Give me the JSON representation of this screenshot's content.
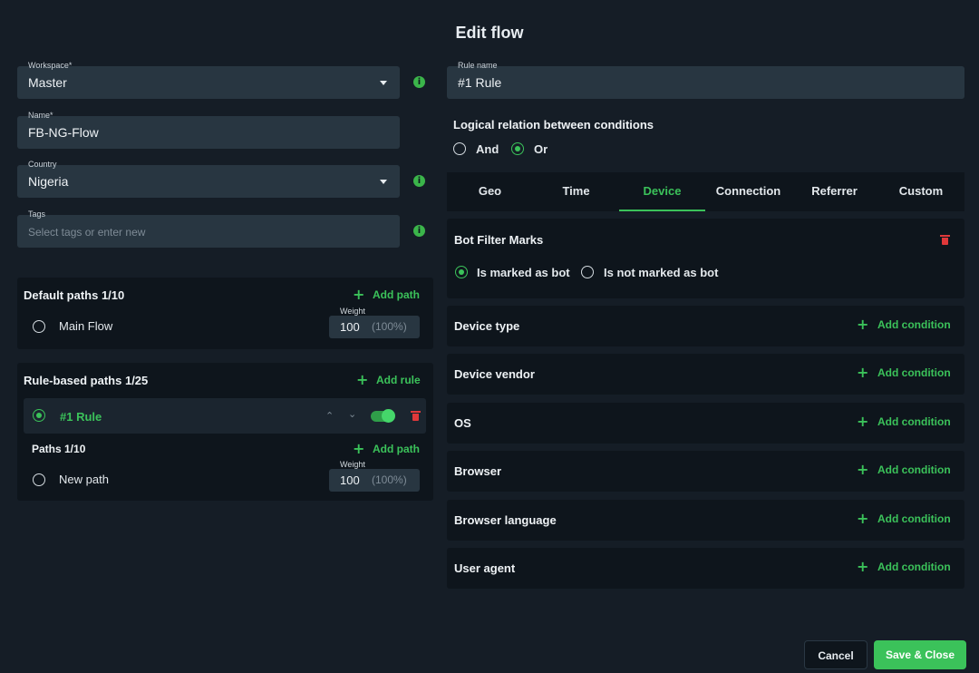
{
  "dialog": {
    "title": "Edit flow"
  },
  "form": {
    "workspace": {
      "label": "Workspace*",
      "value": "Master"
    },
    "name": {
      "label": "Name*",
      "value": "FB-NG-Flow"
    },
    "country": {
      "label": "Country",
      "value": "Nigeria"
    },
    "tags": {
      "label": "Tags",
      "placeholder": "Select tags or enter new"
    }
  },
  "default_paths": {
    "title": "Default paths 1/10",
    "add_label": "Add path",
    "items": [
      {
        "name": "Main Flow",
        "weight_label": "Weight",
        "weight": "100",
        "percent": "(100%)"
      }
    ]
  },
  "rule_paths": {
    "title": "Rule-based paths 1/25",
    "add_label": "Add rule",
    "rule": {
      "name": "#1 Rule",
      "enabled": true
    },
    "paths_title": "Paths 1/10",
    "add_path_label": "Add path",
    "items": [
      {
        "name": "New path",
        "weight_label": "Weight",
        "weight": "100",
        "percent": "(100%)"
      }
    ]
  },
  "rule": {
    "name_label": "Rule name",
    "name_value": "#1 Rule",
    "logic_title": "Logical relation between conditions",
    "logic_options": [
      "And",
      "Or"
    ],
    "logic_selected": "Or"
  },
  "tabs": [
    "Geo",
    "Time",
    "Device",
    "Connection",
    "Referrer",
    "Custom"
  ],
  "active_tab": "Device",
  "bot_filter": {
    "title": "Bot Filter Marks",
    "options": [
      "Is marked as bot",
      "Is not marked as bot"
    ],
    "selected": "Is marked as bot"
  },
  "conditions": {
    "add_label": "Add condition",
    "rows": [
      "Device type",
      "Device vendor",
      "OS",
      "Browser",
      "Browser language",
      "User agent"
    ]
  },
  "buttons": {
    "cancel": "Cancel",
    "save": "Save & Close"
  },
  "icons": {
    "info": "info-icon",
    "dropdown": "chevron-down-icon",
    "delete": "trash-icon",
    "add": "plus-icon"
  },
  "colors": {
    "accent": "#3bc25a",
    "danger": "#e0383a",
    "background": "#151d26"
  }
}
